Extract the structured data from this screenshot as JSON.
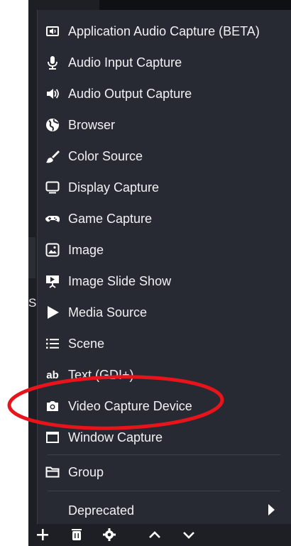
{
  "menu": {
    "items": [
      {
        "label": "Application Audio Capture (BETA)",
        "icon": "app-audio-icon"
      },
      {
        "label": "Audio Input Capture",
        "icon": "microphone-icon"
      },
      {
        "label": "Audio Output Capture",
        "icon": "speaker-icon"
      },
      {
        "label": "Browser",
        "icon": "globe-icon"
      },
      {
        "label": "Color Source",
        "icon": "brush-icon"
      },
      {
        "label": "Display Capture",
        "icon": "monitor-icon"
      },
      {
        "label": "Game Capture",
        "icon": "gamepad-icon"
      },
      {
        "label": "Image",
        "icon": "image-icon"
      },
      {
        "label": "Image Slide Show",
        "icon": "slideshow-icon"
      },
      {
        "label": "Media Source",
        "icon": "play-icon"
      },
      {
        "label": "Scene",
        "icon": "list-icon"
      },
      {
        "label": "Text (GDI+)",
        "icon": "text-icon"
      },
      {
        "label": "Video Capture Device",
        "icon": "camera-icon"
      },
      {
        "label": "Window Capture",
        "icon": "window-icon"
      }
    ],
    "group_label": "Group",
    "group_icon": "folder-icon",
    "deprecated_label": "Deprecated"
  },
  "dock_letter": "S",
  "toolbar": {
    "buttons": [
      "add-icon",
      "trash-icon",
      "gear-icon",
      "chevron-up-icon",
      "chevron-down-icon"
    ]
  },
  "colors": {
    "menu_bg": "#272a33",
    "app_bg": "#1e1f25",
    "text": "#f2f2f5",
    "annotation": "#e8141b"
  }
}
